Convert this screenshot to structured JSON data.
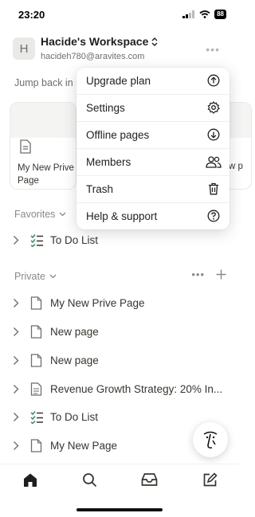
{
  "status_bar": {
    "time": "23:20",
    "battery": "88"
  },
  "workspace": {
    "avatar_letter": "H",
    "name": "Hacide's Workspace",
    "email": "hacideh780@aravites.com"
  },
  "jump_back_label": "Jump back in",
  "recent_cards": [
    {
      "label": "My New Prive Page"
    },
    {
      "label_partial": "w p"
    }
  ],
  "menu": {
    "items": [
      {
        "label": "Upgrade plan",
        "icon": "arrow-up-circle-icon"
      },
      {
        "label": "Settings",
        "icon": "gear-icon"
      },
      {
        "label": "Offline pages",
        "icon": "arrow-down-circle-icon"
      },
      {
        "label": "Members",
        "icon": "people-icon"
      },
      {
        "label": "Trash",
        "icon": "trash-icon"
      },
      {
        "label": "Help & support",
        "icon": "question-circle-icon"
      }
    ]
  },
  "favorites": {
    "label": "Favorites",
    "items": [
      {
        "label": "To Do List",
        "icon": "checklist-icon"
      }
    ]
  },
  "private": {
    "label": "Private",
    "items": [
      {
        "label": "My New Prive Page",
        "icon": "page-icon"
      },
      {
        "label": "New page",
        "icon": "page-icon"
      },
      {
        "label": "New page",
        "icon": "page-icon"
      },
      {
        "label": "Revenue Growth Strategy: 20% In...",
        "icon": "page-text-icon"
      },
      {
        "label": "To Do List",
        "icon": "checklist-icon"
      },
      {
        "label": "My New Page",
        "icon": "page-icon"
      }
    ]
  },
  "tabbar": {
    "tabs": [
      {
        "name": "home-icon"
      },
      {
        "name": "search-icon"
      },
      {
        "name": "inbox-icon"
      },
      {
        "name": "compose-icon"
      }
    ]
  },
  "colors": {
    "checklist_green": "#2f8f5b",
    "text": "#37352f",
    "muted": "#8a8984"
  }
}
